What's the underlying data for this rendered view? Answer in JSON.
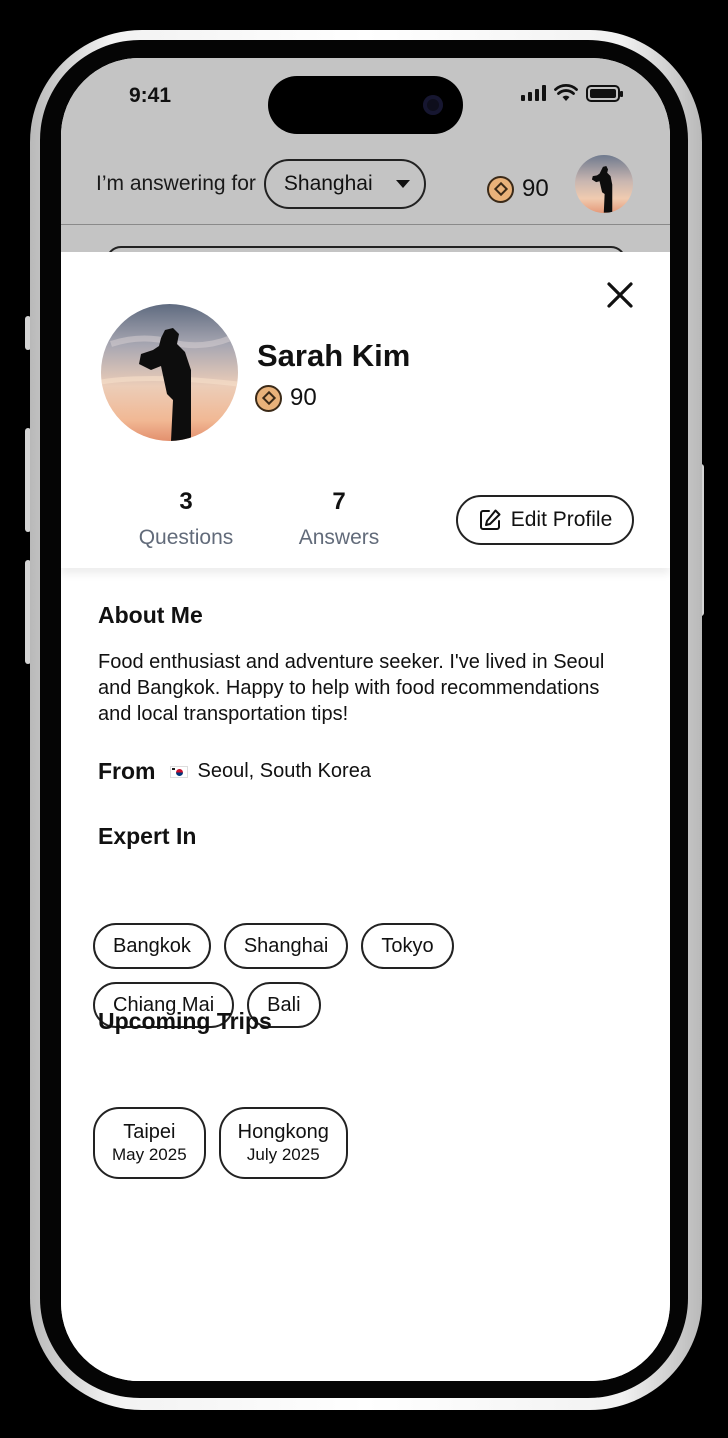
{
  "status_bar": {
    "time": "9:41"
  },
  "header": {
    "answering_label": "I’m answering for",
    "selected_city": "Shanghai",
    "coins": "90"
  },
  "profile": {
    "name": "Sarah Kim",
    "coins": "90",
    "questions_count": "3",
    "questions_label": "Questions",
    "answers_count": "7",
    "answers_label": "Answers",
    "edit_label": "Edit Profile"
  },
  "about": {
    "title": "About Me",
    "text": "Food enthusiast and adventure seeker. I've lived in Seoul and Bangkok. Happy to help with food recommendations and local transportation tips!"
  },
  "from": {
    "title": "From",
    "location": "Seoul, South Korea"
  },
  "expert": {
    "title": "Expert In",
    "cities": [
      "Bangkok",
      "Shanghai",
      "Tokyo",
      "Chiang Mai",
      "Bali"
    ]
  },
  "trips": {
    "title": "Upcoming Trips",
    "items": [
      {
        "city": "Taipei",
        "date": "May 2025"
      },
      {
        "city": "Hongkong",
        "date": "July 2025"
      }
    ]
  },
  "icons": {
    "close": "close-icon",
    "edit": "edit-icon",
    "coin": "coin-icon"
  }
}
